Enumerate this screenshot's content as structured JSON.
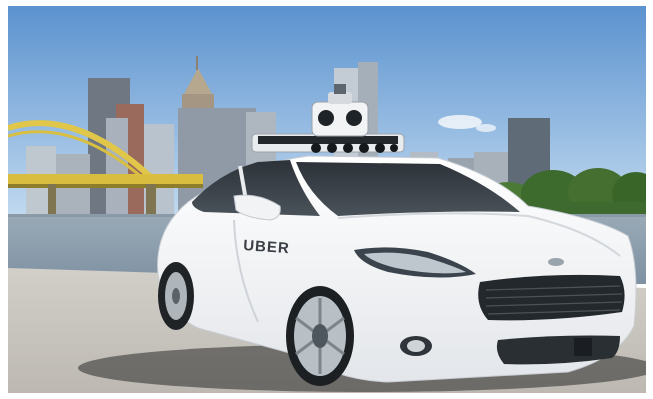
{
  "photo": {
    "subject": "car",
    "car_lettering": "UBER",
    "colors": {
      "sky_top": "#5c93cf",
      "sky_bottom": "#bcd6ee",
      "water": "#8fa3b5",
      "pavement": "#c9c6c0",
      "car_body": "#f4f6f8",
      "bridge": "#e1c94a",
      "trees": "#3f6a2f",
      "buildings": "#8c97a3"
    }
  }
}
